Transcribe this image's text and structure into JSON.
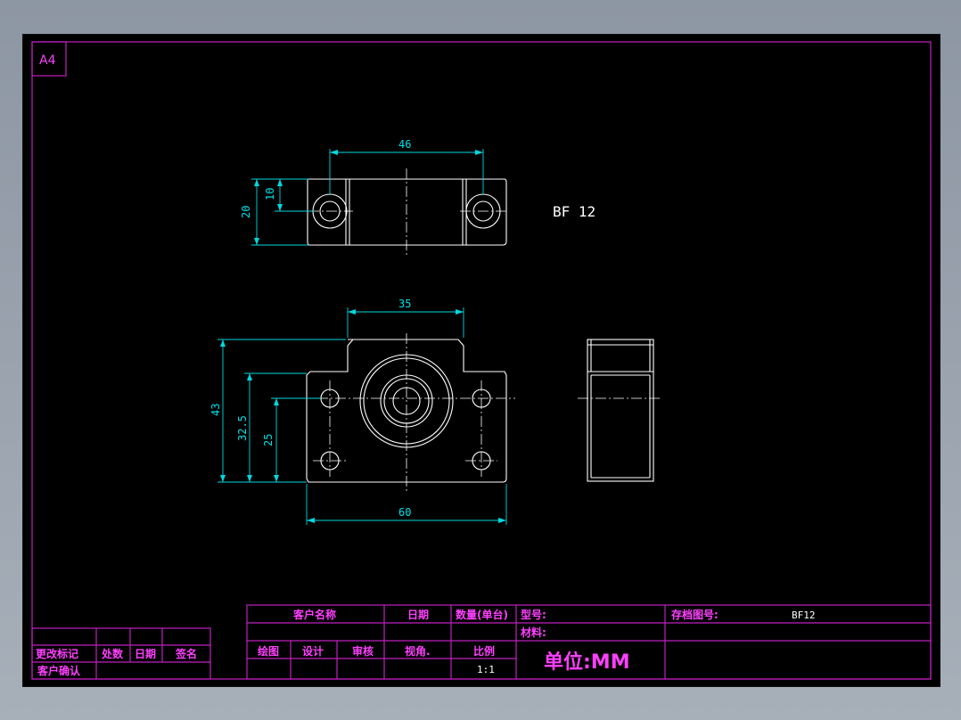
{
  "sheet": {
    "size_label": "A4",
    "part_label": "BF 12"
  },
  "dimensions": {
    "top_width": "46",
    "top_inner_height": "10",
    "top_height": "20",
    "front_top_width": "35",
    "front_height": "43",
    "front_mid_height": "32.5",
    "front_hole_height": "25",
    "front_width": "60"
  },
  "title_block": {
    "customer_name": "客户名称",
    "date": "日期",
    "quantity": "数量(单台)",
    "model": "型号:",
    "archive_no": "存档图号:",
    "archive_value": "BF12",
    "material": "材料:",
    "drawn": "绘图",
    "design": "设计",
    "review": "审核",
    "view_angle": "视角.",
    "scale_label": "比例",
    "scale_value": "1:1",
    "unit": "单位:MM",
    "rev_mark": "更改标记",
    "rev_count": "处数",
    "rev_date": "日期",
    "signature": "签名",
    "customer_confirm": "客户确认"
  }
}
